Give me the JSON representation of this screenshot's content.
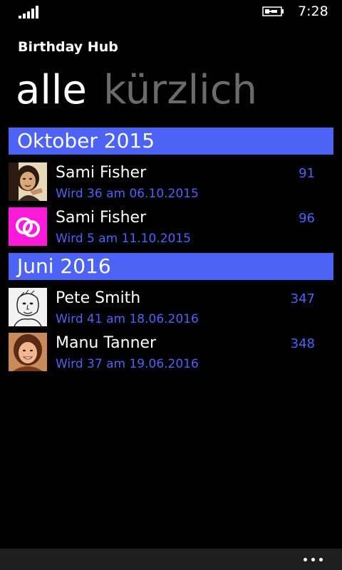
{
  "status_bar": {
    "time": "7:28",
    "signal_icon": "signal-strength-icon",
    "battery_icon": "battery-charging-icon"
  },
  "app": {
    "title": "Birthday Hub"
  },
  "pivot": {
    "tabs": [
      {
        "label": "alle",
        "active": true
      },
      {
        "label": "kürzlich",
        "active": false
      }
    ]
  },
  "colors": {
    "accent": "#4d63f5",
    "background": "#000000",
    "inactive_pivot": "#6b6b6b",
    "app_bar": "#1f1f1f"
  },
  "groups": [
    {
      "header": "Oktober 2015",
      "items": [
        {
          "name": "Sami Fisher",
          "detail": "Wird 36 am 06.10.2015",
          "days": "91",
          "avatar": "portrait-photo-avatar"
        },
        {
          "name": "Sami Fisher",
          "detail": "Wird 5 am 11.10.2015",
          "days": "96",
          "avatar": "rings-icon-avatar"
        }
      ]
    },
    {
      "header": "Juni 2016",
      "items": [
        {
          "name": "Pete Smith",
          "detail": "Wird 41 am 18.06.2016",
          "days": "347",
          "avatar": "sketch-portrait-avatar"
        },
        {
          "name": "Manu Tanner",
          "detail": "Wird 37 am 19.06.2016",
          "days": "348",
          "avatar": "portrait-photo-avatar"
        }
      ]
    }
  ],
  "app_bar": {
    "more_icon": "ellipsis-icon"
  }
}
